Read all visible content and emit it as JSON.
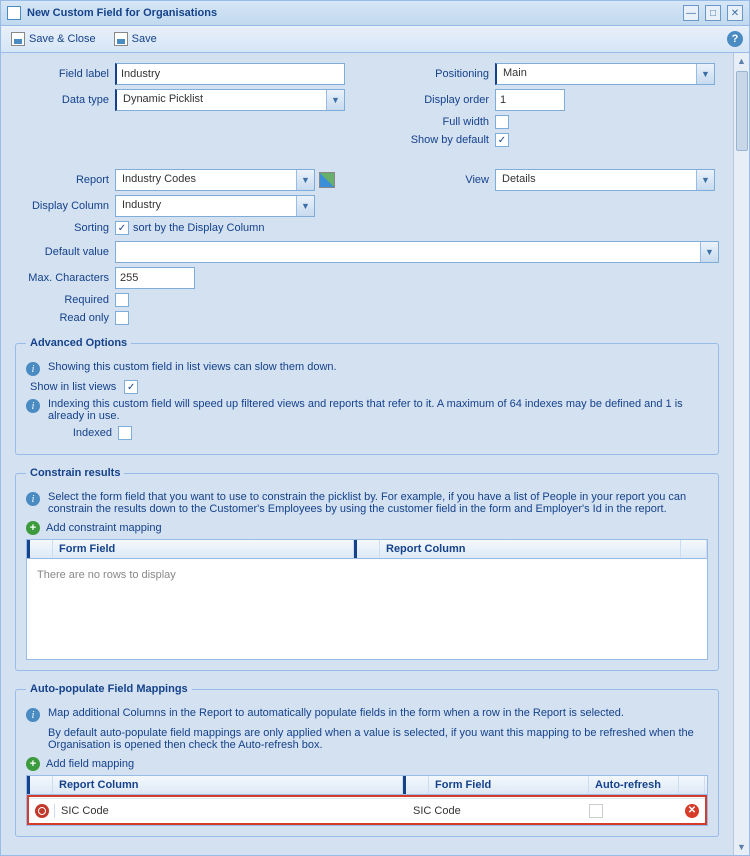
{
  "window": {
    "title": "New Custom Field for Organisations"
  },
  "toolbar": {
    "save_close": "Save & Close",
    "save": "Save"
  },
  "left": {
    "field_label_lbl": "Field label",
    "field_label_val": "Industry",
    "data_type_lbl": "Data type",
    "data_type_val": "Dynamic Picklist",
    "report_lbl": "Report",
    "report_val": "Industry Codes",
    "disp_col_lbl": "Display Column",
    "disp_col_val": "Industry",
    "sorting_lbl": "Sorting",
    "sorting_text": "sort by the Display Column",
    "default_lbl": "Default value",
    "default_val": "",
    "maxchar_lbl": "Max. Characters",
    "maxchar_val": "255",
    "required_lbl": "Required",
    "readonly_lbl": "Read only"
  },
  "right": {
    "positioning_lbl": "Positioning",
    "positioning_val": "Main",
    "disp_order_lbl": "Display order",
    "disp_order_val": "1",
    "fullwidth_lbl": "Full width",
    "showdefault_lbl": "Show by default",
    "view_lbl": "View",
    "view_val": "Details"
  },
  "adv": {
    "legend": "Advanced Options",
    "info1": "Showing this custom field in list views can slow them down.",
    "show_in_lists_lbl": "Show in list views",
    "info2": "Indexing this custom field will speed up filtered views and reports that refer to it. A maximum of 64 indexes may be defined and 1 is already in use.",
    "indexed_lbl": "Indexed"
  },
  "constrain": {
    "legend": "Constrain results",
    "info": "Select the form field that you want to use to constrain the picklist by. For example, if you have a list of People in your report you can constrain the results down to the Customer's Employees by using the customer field in the form and Employer's Id in the report.",
    "add": "Add constraint mapping",
    "col_form": "Form Field",
    "col_report": "Report Column",
    "empty": "There are no rows to display"
  },
  "autopop": {
    "legend": "Auto-populate Field Mappings",
    "info1": "Map additional Columns in the Report to automatically populate fields in the form when a row in the Report is selected.",
    "info2": "By default auto-populate field mappings are only applied when a value is selected, if you want this mapping to be refreshed when the Organisation is opened then check the Auto-refresh box.",
    "add": "Add field mapping",
    "col_report": "Report Column",
    "col_form": "Form Field",
    "col_autorefresh": "Auto-refresh",
    "rows": [
      {
        "report_col": "SIC Code",
        "form_field": "SIC Code",
        "autorefresh": false
      }
    ]
  }
}
